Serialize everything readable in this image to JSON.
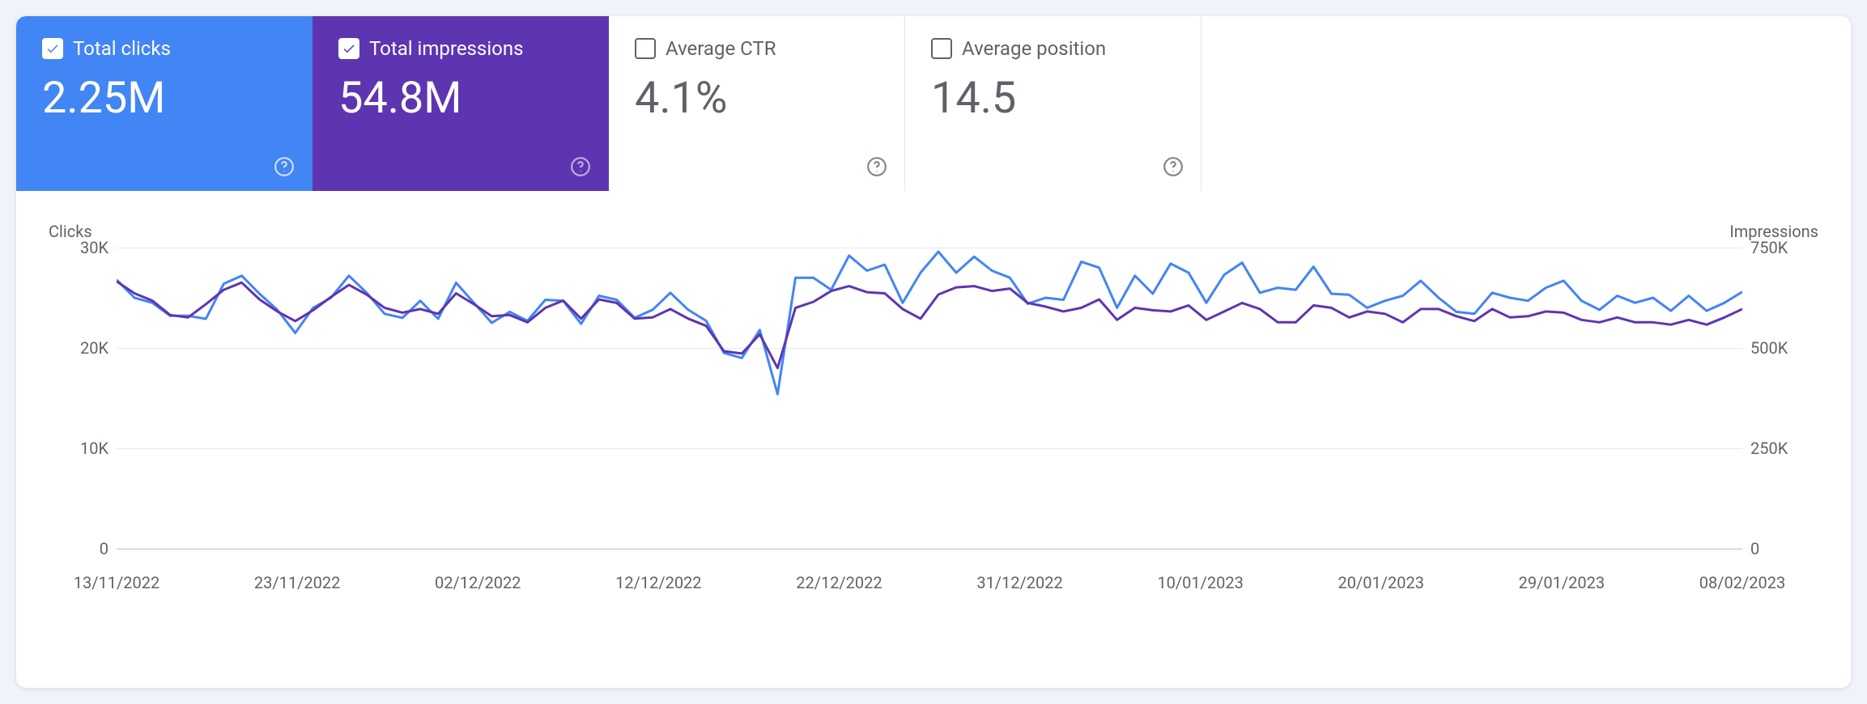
{
  "metrics": {
    "clicks": {
      "label": "Total clicks",
      "value": "2.25M",
      "checked": true
    },
    "impressions": {
      "label": "Total impressions",
      "value": "54.8M",
      "checked": true
    },
    "ctr": {
      "label": "Average CTR",
      "value": "4.1%",
      "checked": false
    },
    "position": {
      "label": "Average position",
      "value": "14.5",
      "checked": false
    }
  },
  "axes": {
    "left": {
      "title": "Clicks",
      "ticks": [
        "30K",
        "20K",
        "10K",
        "0"
      ],
      "range": [
        0,
        30000
      ]
    },
    "right": {
      "title": "Impressions",
      "ticks": [
        "750K",
        "500K",
        "250K",
        "0"
      ],
      "range": [
        0,
        750000
      ]
    },
    "x": {
      "labels": [
        "13/11/2022",
        "23/11/2022",
        "02/12/2022",
        "12/12/2022",
        "22/12/2022",
        "31/12/2022",
        "10/01/2023",
        "20/01/2023",
        "29/01/2023",
        "08/02/2023"
      ]
    }
  },
  "chart_data": {
    "type": "line",
    "x_label_dates": [
      "13/11/2022",
      "23/11/2022",
      "02/12/2022",
      "12/12/2022",
      "22/12/2022",
      "31/12/2022",
      "10/01/2023",
      "20/01/2023",
      "29/01/2023",
      "08/02/2023"
    ],
    "series": [
      {
        "name": "Clicks",
        "axis": "left",
        "color": "#4285f4",
        "values": [
          26800,
          25000,
          24500,
          23200,
          23200,
          22900,
          26400,
          27200,
          25400,
          23800,
          21500,
          24000,
          25000,
          27200,
          25500,
          23400,
          23000,
          24700,
          22900,
          26500,
          24500,
          22500,
          23600,
          22700,
          24800,
          24700,
          22400,
          25200,
          24800,
          23000,
          23800,
          25500,
          23800,
          22700,
          19500,
          19000,
          21800,
          15400,
          27000,
          27000,
          25800,
          29200,
          27700,
          28300,
          24500,
          27500,
          29600,
          27500,
          29100,
          27700,
          27000,
          24400,
          25000,
          24800,
          28600,
          28000,
          24000,
          27200,
          25400,
          28400,
          27500,
          24500,
          27300,
          28500,
          25500,
          26000,
          25800,
          28100,
          25400,
          25300,
          24000,
          24700,
          25200,
          26700,
          25000,
          23600,
          23400,
          25500,
          25000,
          24700,
          26000,
          26700,
          24700,
          23800,
          25200,
          24500,
          25000,
          23700,
          25200,
          23700,
          24500,
          25600
        ]
      },
      {
        "name": "Impressions",
        "axis": "right",
        "color": "#5e35b1",
        "values": [
          666000,
          636000,
          618000,
          582000,
          576000,
          609000,
          645000,
          663000,
          621000,
          591000,
          567000,
          594000,
          627000,
          657000,
          633000,
          600000,
          588000,
          597000,
          585000,
          636000,
          609000,
          579000,
          582000,
          564000,
          600000,
          618000,
          573000,
          621000,
          612000,
          573000,
          576000,
          597000,
          573000,
          555000,
          492000,
          486000,
          534000,
          450000,
          600000,
          615000,
          642000,
          654000,
          639000,
          636000,
          597000,
          573000,
          633000,
          651000,
          654000,
          642000,
          648000,
          612000,
          603000,
          591000,
          600000,
          621000,
          570000,
          600000,
          594000,
          591000,
          606000,
          570000,
          591000,
          612000,
          597000,
          564000,
          564000,
          606000,
          600000,
          576000,
          591000,
          585000,
          564000,
          597000,
          597000,
          579000,
          567000,
          597000,
          576000,
          579000,
          591000,
          588000,
          570000,
          564000,
          576000,
          564000,
          564000,
          558000,
          570000,
          558000,
          576000,
          597000
        ]
      }
    ]
  }
}
